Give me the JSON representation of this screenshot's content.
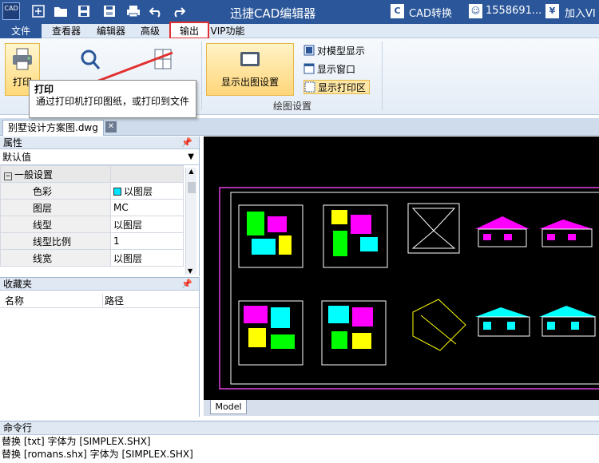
{
  "title_bar": {
    "app_logo_text": "CAD",
    "title": "迅捷CAD编辑器",
    "cad_switch_label": "CAD转换",
    "user_id": "1558691...",
    "vip_label": "加入VI"
  },
  "menu": {
    "items": [
      "文件",
      "查看器",
      "编辑器",
      "高级",
      "输出",
      "VIP功能"
    ],
    "active_item": "输出"
  },
  "ribbon": {
    "print_label": "打印",
    "show_layout_label": "显示出图设置",
    "model_display_label": "对模型显示",
    "show_window_label": "显示窗口",
    "show_print_area_label": "显示打印区",
    "draw_settings_group": "绘图设置"
  },
  "tooltip": {
    "title": "打印",
    "body": "通过打印机打印图纸，或打印到文件"
  },
  "doc_tab": {
    "filename": "别墅设计方案图.dwg"
  },
  "properties_panel": {
    "title": "属性",
    "pin": "ㅁ",
    "combo_value": "默认值",
    "category": "一般设置",
    "rows": [
      {
        "key": "色彩",
        "value": "以图层"
      },
      {
        "key": "图层",
        "value": "MC"
      },
      {
        "key": "线型",
        "value": "以图层"
      },
      {
        "key": "线型比例",
        "value": "1"
      },
      {
        "key": "线宽",
        "value": "以图层"
      }
    ],
    "color_swatch": "#00e5ff"
  },
  "favorites_panel": {
    "title": "收藏夹",
    "col_name": "名称",
    "col_path": "路径"
  },
  "canvas": {
    "model_tab": "Model"
  },
  "command_line": {
    "title": "命令行",
    "lines": [
      "替换 [txt] 字体为 [SIMPLEX.SHX]",
      "替换 [romans.shx] 字体为 [SIMPLEX.SHX]"
    ]
  },
  "colors": {
    "title_bar": "#2b579a",
    "highlight_border": "#e03030",
    "ribbon_selected": "#ffd97a",
    "canvas_bg": "#000000"
  }
}
